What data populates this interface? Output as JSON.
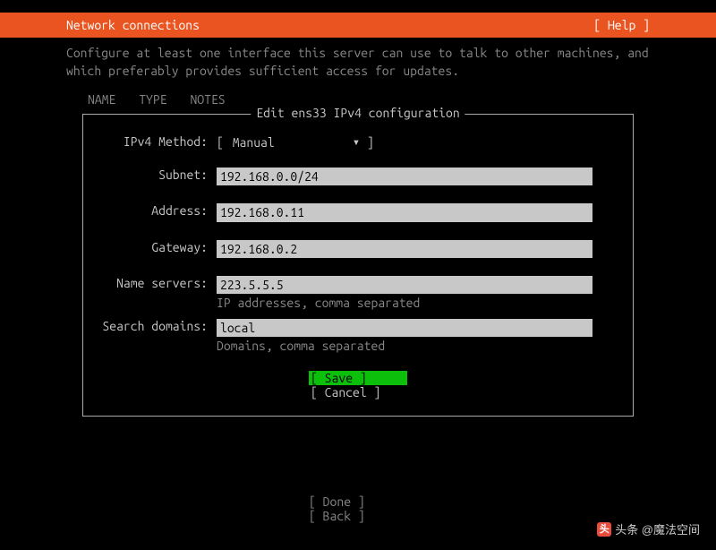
{
  "header": {
    "title": "Network connections",
    "help": "[ Help ]"
  },
  "description": "Configure at least one interface this server can use to talk to other machines, and which preferably provides sufficient access for updates.",
  "columns": {
    "name": "NAME",
    "type": "TYPE",
    "notes": "NOTES"
  },
  "box": {
    "title": "Edit ens33 IPv4 configuration",
    "method_label": "IPv4 Method:",
    "method_open": "[",
    "method_value": "Manual",
    "method_caret": "▾",
    "method_close": "]",
    "fields": {
      "subnet": {
        "label": "Subnet:",
        "value": "192.168.0.0/24",
        "hint": ""
      },
      "address": {
        "label": "Address:",
        "value": "192.168.0.11",
        "hint": ""
      },
      "gateway": {
        "label": "Gateway:",
        "value": "192.168.0.2",
        "hint": ""
      },
      "nameservers": {
        "label": "Name servers:",
        "value": "223.5.5.5",
        "hint": "IP addresses, comma separated"
      },
      "searchdomains": {
        "label": "Search domains:",
        "value": "local",
        "hint": "Domains, comma separated"
      }
    },
    "buttons": {
      "save": "[ Save       ]",
      "cancel": "[ Cancel     ]"
    }
  },
  "footer": {
    "done": "[ Done       ]",
    "back": "[ Back       ]"
  },
  "watermark": "头条 @魔法空间"
}
